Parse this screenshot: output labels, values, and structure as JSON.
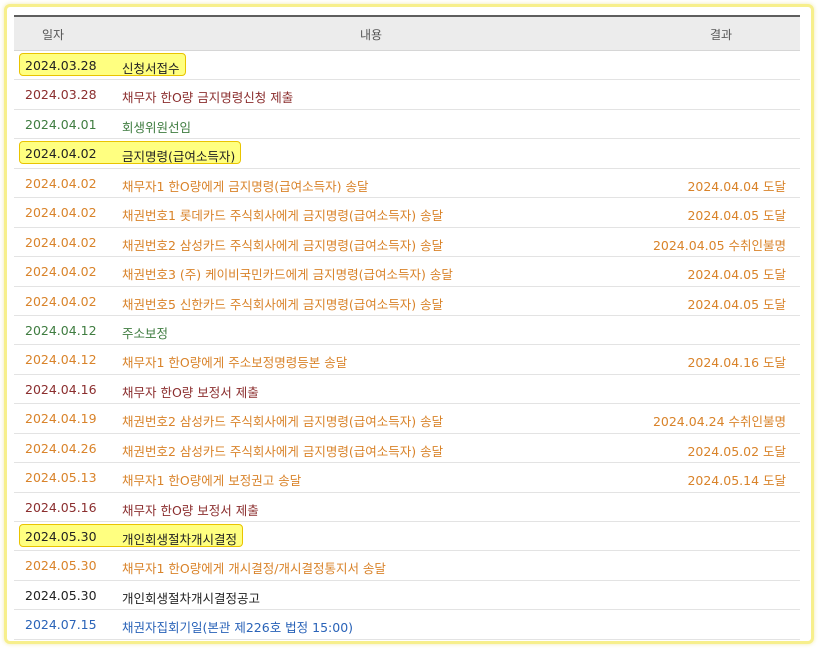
{
  "header": {
    "date": "일자",
    "content": "내용",
    "result": "결과"
  },
  "rows": [
    {
      "date": "2024.03.28",
      "text": "신청서접수",
      "result": "",
      "color": "black",
      "highlight": true
    },
    {
      "date": "2024.03.28",
      "text": "채무자 한O량 금지명령신청 제출",
      "result": "",
      "color": "maroon",
      "highlight": false
    },
    {
      "date": "2024.04.01",
      "text": "회생위원선임",
      "result": "",
      "color": "green",
      "highlight": false
    },
    {
      "date": "2024.04.02",
      "text": "금지명령(급여소득자)",
      "result": "",
      "color": "black",
      "highlight": true
    },
    {
      "date": "2024.04.02",
      "text": "채무자1 한O량에게 금지명령(급여소득자) 송달",
      "result": "2024.04.04 도달",
      "color": "orange",
      "highlight": false
    },
    {
      "date": "2024.04.02",
      "text": "채권번호1 롯데카드 주식회사에게 금지명령(급여소득자) 송달",
      "result": "2024.04.05 도달",
      "color": "orange",
      "highlight": false
    },
    {
      "date": "2024.04.02",
      "text": "채권번호2 삼성카드 주식회사에게 금지명령(급여소득자) 송달",
      "result": "2024.04.05 수취인불명",
      "color": "orange",
      "highlight": false
    },
    {
      "date": "2024.04.02",
      "text": "채권번호3 (주) 케이비국민카드에게 금지명령(급여소득자) 송달",
      "result": "2024.04.05 도달",
      "color": "orange",
      "highlight": false
    },
    {
      "date": "2024.04.02",
      "text": "채권번호5 신한카드 주식회사에게 금지명령(급여소득자) 송달",
      "result": "2024.04.05 도달",
      "color": "orange",
      "highlight": false
    },
    {
      "date": "2024.04.12",
      "text": "주소보정",
      "result": "",
      "color": "green",
      "highlight": false
    },
    {
      "date": "2024.04.12",
      "text": "채무자1 한O량에게 주소보정명령등본 송달",
      "result": "2024.04.16 도달",
      "color": "orange",
      "highlight": false
    },
    {
      "date": "2024.04.16",
      "text": "채무자 한O량 보정서 제출",
      "result": "",
      "color": "maroon",
      "highlight": false
    },
    {
      "date": "2024.04.19",
      "text": "채권번호2 삼성카드 주식회사에게 금지명령(급여소득자) 송달",
      "result": "2024.04.24 수취인불명",
      "color": "orange",
      "highlight": false
    },
    {
      "date": "2024.04.26",
      "text": "채권번호2 삼성카드 주식회사에게 금지명령(급여소득자) 송달",
      "result": "2024.05.02 도달",
      "color": "orange",
      "highlight": false
    },
    {
      "date": "2024.05.13",
      "text": "채무자1 한O량에게 보정권고 송달",
      "result": "2024.05.14 도달",
      "color": "orange",
      "highlight": false
    },
    {
      "date": "2024.05.16",
      "text": "채무자 한O량 보정서 제출",
      "result": "",
      "color": "maroon",
      "highlight": false
    },
    {
      "date": "2024.05.30",
      "text": "개인회생절차개시결정",
      "result": "",
      "color": "black",
      "highlight": true
    },
    {
      "date": "2024.05.30",
      "text": "채무자1 한O량에게 개시결정/개시결정통지서 송달",
      "result": "",
      "color": "orange",
      "highlight": false
    },
    {
      "date": "2024.05.30",
      "text": "개인회생절차개시결정공고",
      "result": "",
      "color": "black",
      "highlight": false
    },
    {
      "date": "2024.07.15",
      "text": "채권자집회기일(본관 제226호 법정 15:00)",
      "result": "",
      "color": "blue",
      "highlight": false
    }
  ],
  "colors": {
    "black": "#222222",
    "maroon": "#8b2e2e",
    "green": "#3f7c40",
    "orange": "#d9832a",
    "blue": "#2a63b8",
    "highlight": "#ffff80"
  }
}
